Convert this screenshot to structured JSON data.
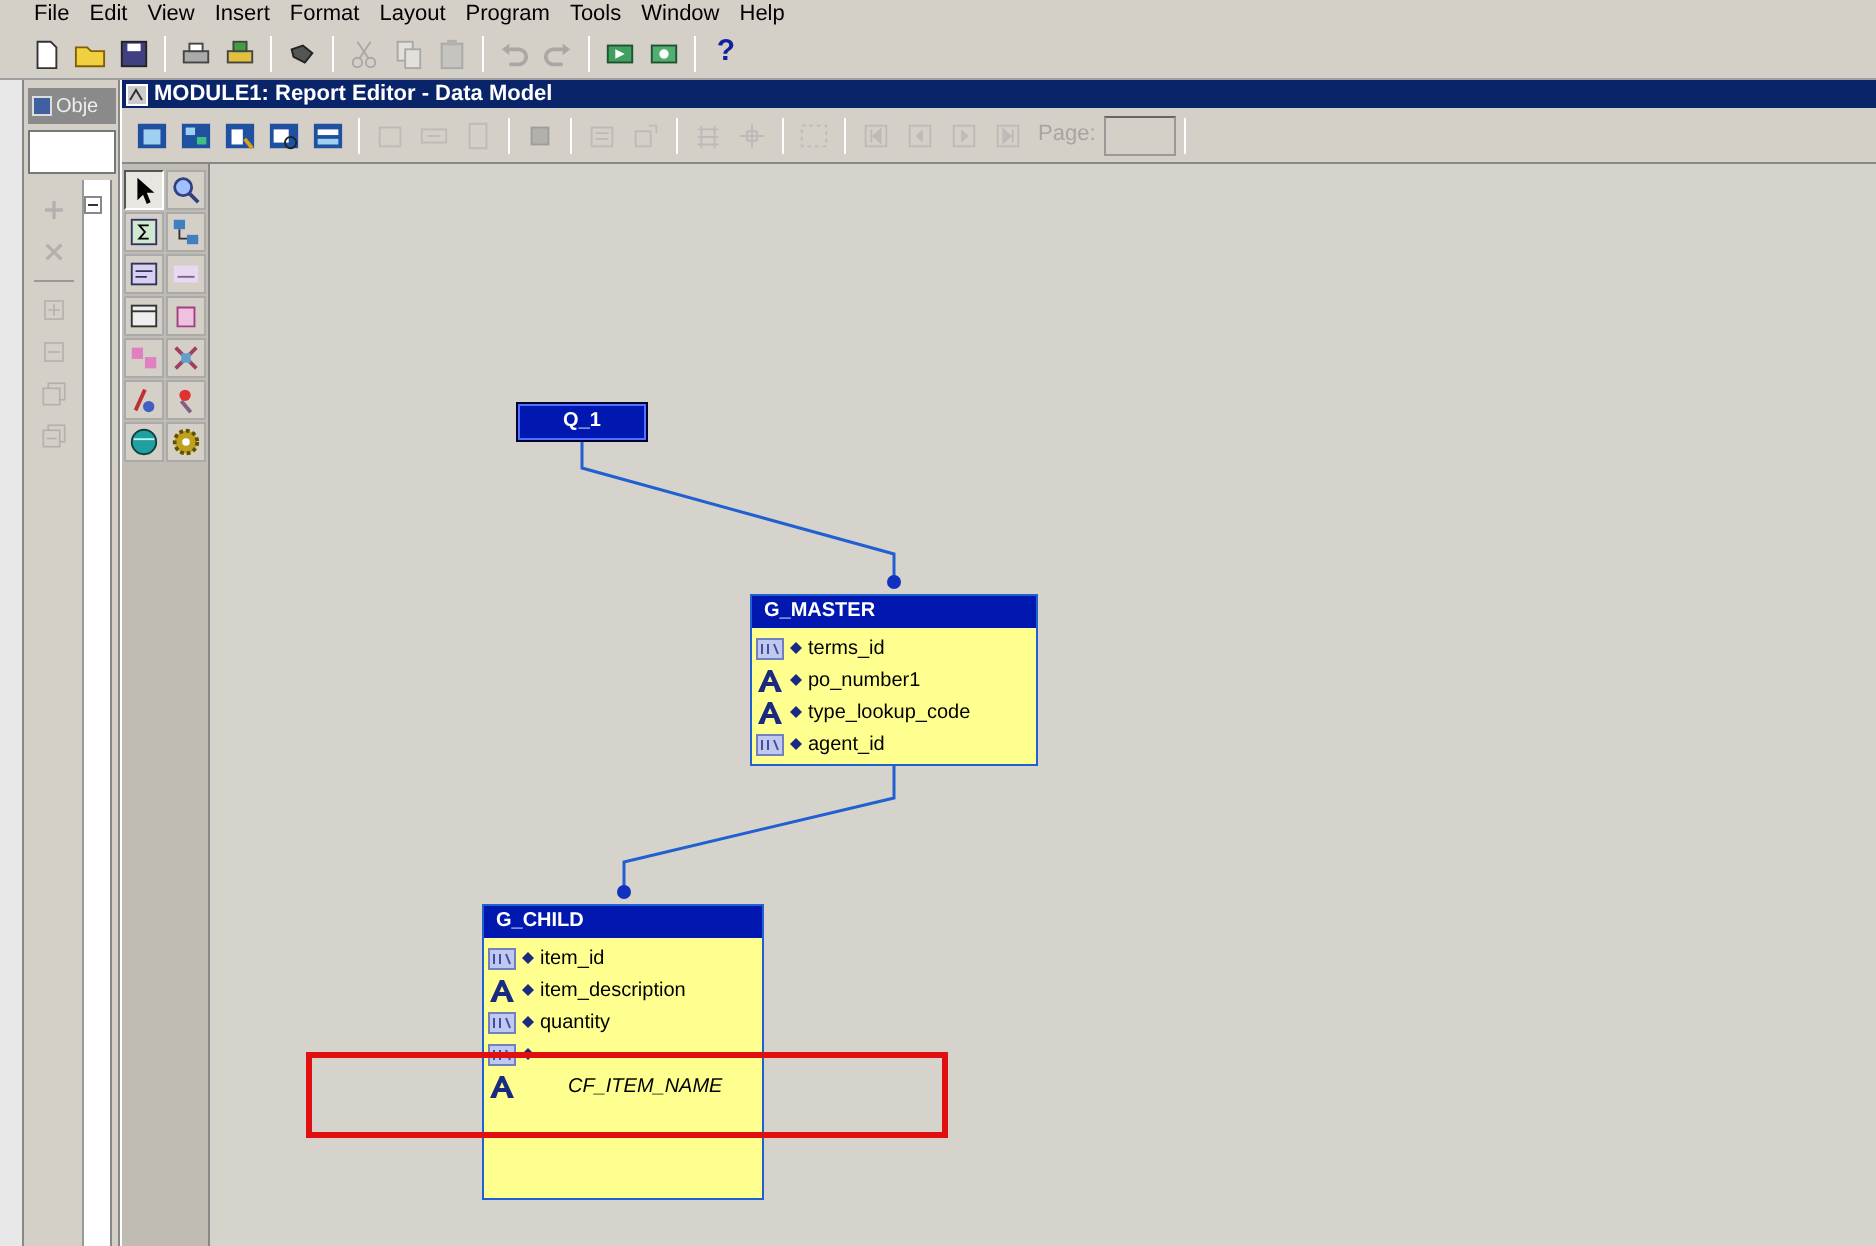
{
  "menu": [
    {
      "label": "File"
    },
    {
      "label": "Edit"
    },
    {
      "label": "View"
    },
    {
      "label": "Insert"
    },
    {
      "label": "Format"
    },
    {
      "label": "Layout"
    },
    {
      "label": "Program"
    },
    {
      "label": "Tools"
    },
    {
      "label": "Window"
    },
    {
      "label": "Help"
    }
  ],
  "toolbar": [
    {
      "kind": "new",
      "disabled": false
    },
    {
      "kind": "open",
      "disabled": false
    },
    {
      "kind": "save",
      "disabled": false
    },
    {
      "kind": "sep"
    },
    {
      "kind": "print",
      "disabled": false
    },
    {
      "kind": "printsetup",
      "disabled": false
    },
    {
      "kind": "sep"
    },
    {
      "kind": "connect",
      "disabled": false
    },
    {
      "kind": "sep"
    },
    {
      "kind": "cut",
      "disabled": true
    },
    {
      "kind": "copy",
      "disabled": true
    },
    {
      "kind": "paste",
      "disabled": true
    },
    {
      "kind": "sep"
    },
    {
      "kind": "undo",
      "disabled": true
    },
    {
      "kind": "redo",
      "disabled": true
    },
    {
      "kind": "sep"
    },
    {
      "kind": "run",
      "disabled": false
    },
    {
      "kind": "debug",
      "disabled": false
    },
    {
      "kind": "sep"
    },
    {
      "kind": "help",
      "disabled": false,
      "label": "?"
    }
  ],
  "navigator": {
    "tab": "Obje",
    "tools": [
      {
        "kind": "add",
        "disabled": true
      },
      {
        "kind": "remove",
        "disabled": true
      },
      {
        "kind": "sep"
      },
      {
        "kind": "expand",
        "disabled": true
      },
      {
        "kind": "collapse",
        "disabled": true
      },
      {
        "kind": "expandall",
        "disabled": true
      },
      {
        "kind": "collapseall",
        "disabled": true
      }
    ]
  },
  "editor": {
    "title": "MODULE1: Report Editor - Data Model",
    "toolbar": [
      {
        "kind": "view1",
        "disabled": false
      },
      {
        "kind": "view2",
        "disabled": false
      },
      {
        "kind": "view3",
        "disabled": false
      },
      {
        "kind": "view4",
        "disabled": false
      },
      {
        "kind": "view5",
        "disabled": false
      },
      {
        "kind": "sep"
      },
      {
        "kind": "frame",
        "disabled": true
      },
      {
        "kind": "field",
        "disabled": true
      },
      {
        "kind": "page",
        "disabled": true
      },
      {
        "kind": "sep"
      },
      {
        "kind": "object",
        "disabled": true
      },
      {
        "kind": "sep"
      },
      {
        "kind": "align",
        "disabled": true
      },
      {
        "kind": "size",
        "disabled": true
      },
      {
        "kind": "sep"
      },
      {
        "kind": "grid",
        "disabled": true
      },
      {
        "kind": "snap",
        "disabled": true
      },
      {
        "kind": "sep"
      },
      {
        "kind": "group",
        "disabled": true
      },
      {
        "kind": "sep"
      },
      {
        "kind": "first",
        "disabled": true
      },
      {
        "kind": "prev",
        "disabled": true
      },
      {
        "kind": "next",
        "disabled": true
      },
      {
        "kind": "last",
        "disabled": true
      }
    ],
    "page_label": "Page:",
    "palette": [
      {
        "kind": "select",
        "selected": true
      },
      {
        "kind": "zoom",
        "selected": false
      },
      {
        "kind": "sum",
        "selected": false
      },
      {
        "kind": "link",
        "selected": false
      },
      {
        "kind": "sql",
        "selected": false
      },
      {
        "kind": "text",
        "selected": false
      },
      {
        "kind": "table",
        "selected": false
      },
      {
        "kind": "ref",
        "selected": false
      },
      {
        "kind": "cross",
        "selected": false
      },
      {
        "kind": "matrix",
        "selected": false
      },
      {
        "kind": "formula",
        "selected": false
      },
      {
        "kind": "placeholder",
        "selected": false
      },
      {
        "kind": "globe",
        "selected": false
      },
      {
        "kind": "gear",
        "selected": false
      }
    ]
  },
  "model": {
    "query": {
      "name": "Q_1"
    },
    "groups": [
      {
        "name": "G_MASTER",
        "columns": [
          {
            "name": "terms_id",
            "kind": "number",
            "formula": false
          },
          {
            "name": "po_number1",
            "kind": "char",
            "formula": false
          },
          {
            "name": "type_lookup_code",
            "kind": "char",
            "formula": false
          },
          {
            "name": "agent_id",
            "kind": "number",
            "formula": false
          }
        ]
      },
      {
        "name": "G_CHILD",
        "columns": [
          {
            "name": "item_id",
            "kind": "number",
            "formula": false
          },
          {
            "name": "item_description",
            "kind": "char",
            "formula": false
          },
          {
            "name": "quantity",
            "kind": "number",
            "formula": false
          },
          {
            "kind": "number",
            "formula": false
          },
          {
            "name": "CF_ITEM_NAME",
            "kind": "char",
            "formula": true
          }
        ]
      }
    ],
    "highlight": true
  }
}
